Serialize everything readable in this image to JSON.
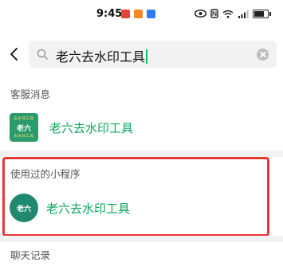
{
  "status": {
    "time": "9:45",
    "network_speed": "5",
    "network_gen": "4G"
  },
  "search": {
    "value": "老六去水印工具"
  },
  "sections": {
    "service_messages": "客服消息",
    "used_mini_programs": "使用过的小程序",
    "chat_history": "聊天记录"
  },
  "results": {
    "service": {
      "name": "老六去水印工具",
      "icon_text": "老六",
      "icon_small_top": "去水印工具",
      "icon_small_bottom": "去水印工具"
    },
    "mini_program": {
      "name": "老六去水印工具",
      "icon_text": "老六"
    }
  },
  "colors": {
    "accent_green": "#07a55c",
    "highlight_red": "#e53935"
  }
}
